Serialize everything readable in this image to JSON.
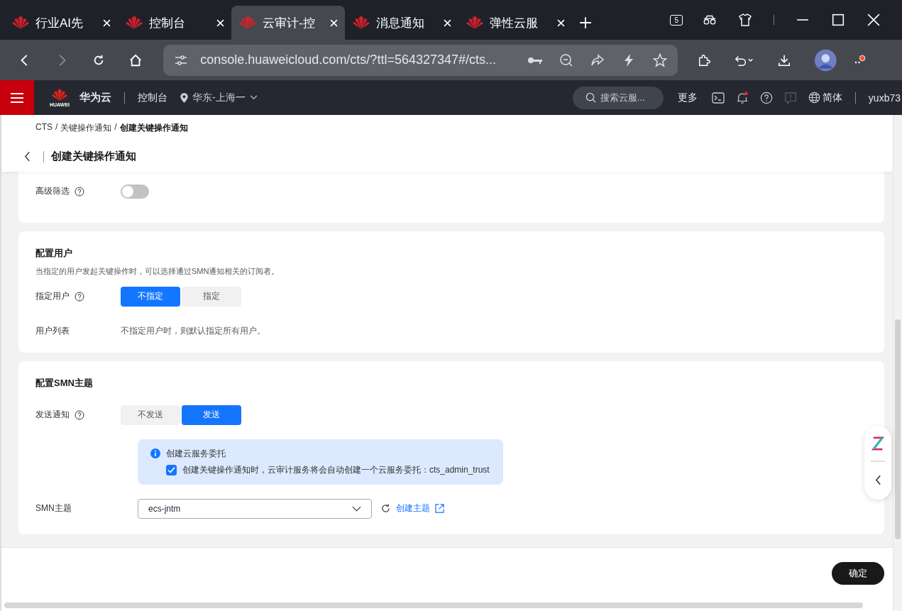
{
  "browser": {
    "tabs": [
      {
        "title": "行业AI先",
        "selected": false
      },
      {
        "title": "控制台",
        "selected": false
      },
      {
        "title": "云审计-控",
        "selected": true
      },
      {
        "title": "消息通知",
        "selected": false
      },
      {
        "title": "弹性云服",
        "selected": false
      }
    ],
    "tab_count": "5",
    "url": "console.huaweicloud.com/cts/?ttl=564327347#/cts...",
    "forward_disabled": true,
    "menu_alert": true
  },
  "header": {
    "brand_logo_text": "HUAWEI",
    "brand": "华为云",
    "console": "控制台",
    "region": "华东-上海一",
    "search_placeholder": "搜索云服...",
    "more": "更多",
    "notifications": true,
    "language": "简体",
    "user": "yuxb73"
  },
  "breadcrumb": {
    "items": [
      "CTS",
      "关键操作通知",
      "创建关键操作通知"
    ],
    "separator": "/"
  },
  "page_title": "创建关键操作通知",
  "advanced_filter": {
    "label": "高级筛选",
    "on": false
  },
  "user_section": {
    "title": "配置用户",
    "description": "当指定的用户发起关键操作时，可以选择通过SMN通知相关的订阅者。",
    "specify": {
      "label": "指定用户",
      "options": [
        {
          "label": "不指定",
          "selected": true
        },
        {
          "label": "指定",
          "selected": false
        }
      ]
    },
    "user_list": {
      "label": "用户列表",
      "value": "不指定用户时，则默认指定所有用户。"
    }
  },
  "smn_section": {
    "title": "配置SMN主题",
    "send": {
      "label": "发送通知",
      "options": [
        {
          "label": "不发送",
          "selected": false
        },
        {
          "label": "发送",
          "selected": true
        }
      ]
    },
    "notice": {
      "title": "创建云服务委托",
      "checked": true,
      "text": "创建关键操作通知时，云审计服务将会自动创建一个云服务委托：cts_admin_trust"
    },
    "topic": {
      "label": "SMN主题",
      "value": "ecs-jntm",
      "create_link": "创建主题"
    }
  },
  "footer": {
    "confirm": "确定"
  }
}
